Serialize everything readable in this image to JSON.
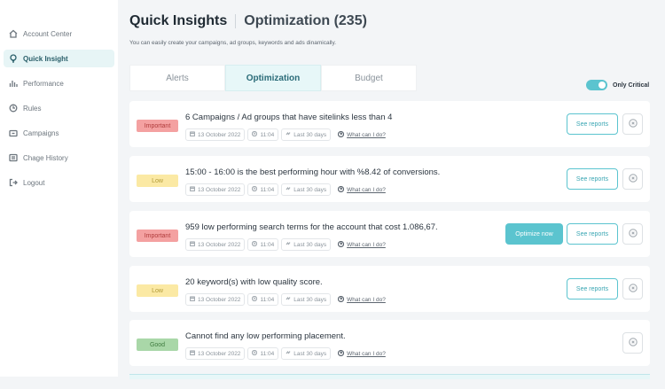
{
  "sidebar": {
    "items": [
      {
        "label": "Account Center",
        "icon": "home-icon"
      },
      {
        "label": "Quick Insight",
        "icon": "lightbulb-icon"
      },
      {
        "label": "Performance",
        "icon": "bar-chart-icon"
      },
      {
        "label": "Rules",
        "icon": "rules-icon"
      },
      {
        "label": "Campaigns",
        "icon": "folder-icon"
      },
      {
        "label": "Chage History",
        "icon": "history-icon"
      },
      {
        "label": "Logout",
        "icon": "logout-icon"
      }
    ]
  },
  "header": {
    "title": "Quick Insights",
    "subtitle": "Optimization (235)",
    "description": "You can easily create your campaigns, ad groups, keywords and ads dinamically."
  },
  "tabs": [
    {
      "label": "Alerts"
    },
    {
      "label": "Optimization"
    },
    {
      "label": "Budget"
    }
  ],
  "toggle": {
    "label": "Only Critical"
  },
  "cards": [
    {
      "badge": "Important",
      "title": "6 Campaigns / Ad groups that have sitelinks less than 4",
      "date": "13 October 2022",
      "time": "11:04",
      "range": "Last 30 days",
      "what": "What can I do?",
      "see": "See reports"
    },
    {
      "badge": "Low",
      "title": "15:00 - 16:00 is the best performing hour with %8.42 of conversions.",
      "date": "13 October 2022",
      "time": "11:04",
      "range": "Last 30 days",
      "what": "What can I do?",
      "see": "See reports"
    },
    {
      "badge": "Important",
      "title": "959 low performing search terms for the account that cost 1.086,67.",
      "date": "13 October 2022",
      "time": "11:04",
      "range": "Last 30 days",
      "what": "What can I do?",
      "see": "See reports",
      "optimize": "Optimize now"
    },
    {
      "badge": "Low",
      "title": "20 keyword(s) with low quality score.",
      "date": "13 October 2022",
      "time": "11:04",
      "range": "Last 30 days",
      "what": "What can I do?",
      "see": "See reports"
    },
    {
      "badge": "Good",
      "title": "Cannot find any low performing placement.",
      "date": "13 October 2022",
      "time": "11:04",
      "range": "Last 30 days",
      "what": "What can I do?"
    }
  ],
  "colors": {
    "accent": "#5bc4cf",
    "important": "#f4a1a1",
    "low": "#fbe9a4",
    "good": "#a9d7a8"
  }
}
